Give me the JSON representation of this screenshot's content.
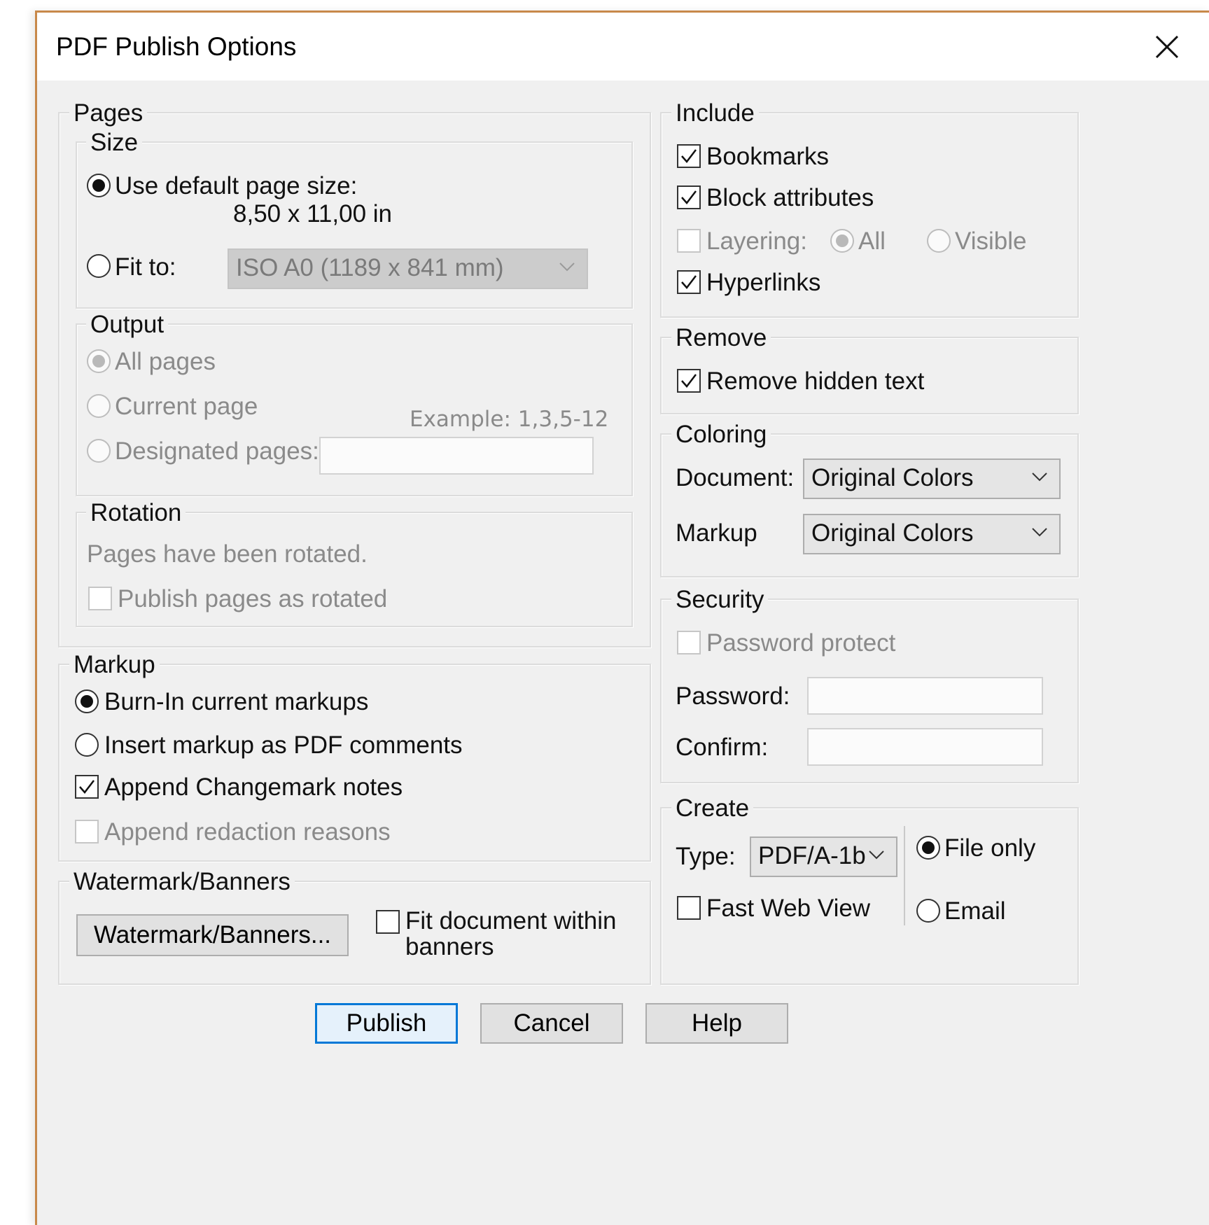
{
  "window": {
    "title": "PDF Publish Options",
    "close_icon": "close-icon"
  },
  "pages": {
    "legend": "Pages",
    "size": {
      "legend": "Size",
      "use_default_label": "Use default page size:",
      "default_size_value": "8,50 x 11,00 in",
      "fit_to_label": "Fit to:",
      "fit_to_value": "ISO A0 (1189 x 841 mm)",
      "selected": "Use default page size:"
    },
    "output": {
      "legend": "Output",
      "all_pages_label": "All pages",
      "current_page_label": "Current page",
      "designated_label": "Designated pages:",
      "designated_example": "Example: 1,3,5-12",
      "designated_value": "",
      "selected": "All pages"
    },
    "rotation": {
      "legend": "Rotation",
      "message": "Pages have been rotated.",
      "publish_rotated_label": "Publish pages as rotated",
      "publish_rotated_checked": false
    }
  },
  "markup": {
    "legend": "Markup",
    "burn_in_label": "Burn-In current markups",
    "insert_comments_label": "Insert markup as PDF comments",
    "selected": "Burn-In current markups",
    "append_changemark_label": "Append Changemark notes",
    "append_changemark_checked": true,
    "append_redaction_label": "Append redaction reasons",
    "append_redaction_checked": false
  },
  "watermark": {
    "legend": "Watermark/Banners",
    "button_label": "Watermark/Banners...",
    "fit_document_label_line1": "Fit document within",
    "fit_document_label_line2": "banners",
    "fit_document_checked": false
  },
  "include": {
    "legend": "Include",
    "bookmarks_label": "Bookmarks",
    "bookmarks_checked": true,
    "block_attributes_label": "Block attributes",
    "block_attributes_checked": true,
    "layering_label": "Layering:",
    "layering_checked": false,
    "layering_all_label": "All",
    "layering_visible_label": "Visible",
    "layering_selected": "All",
    "hyperlinks_label": "Hyperlinks",
    "hyperlinks_checked": true
  },
  "remove": {
    "legend": "Remove",
    "remove_hidden_text_label": "Remove hidden text",
    "remove_hidden_text_checked": true
  },
  "coloring": {
    "legend": "Coloring",
    "document_label": "Document:",
    "document_value": "Original Colors",
    "markup_label": "Markup",
    "markup_value": "Original Colors"
  },
  "security": {
    "legend": "Security",
    "password_protect_label": "Password protect",
    "password_protect_checked": false,
    "password_label": "Password:",
    "password_value": "",
    "confirm_label": "Confirm:",
    "confirm_value": ""
  },
  "create": {
    "legend": "Create",
    "type_label": "Type:",
    "type_value": "PDF/A-1b",
    "fast_web_view_label": "Fast Web View",
    "fast_web_view_checked": false,
    "file_only_label": "File only",
    "email_label": "Email",
    "selected": "File only"
  },
  "buttons": {
    "publish": "Publish",
    "cancel": "Cancel",
    "help": "Help"
  },
  "colors": {
    "accent": "#0078d7",
    "title_border": "#c8894a",
    "dialog_bg": "#f0f0f0"
  }
}
